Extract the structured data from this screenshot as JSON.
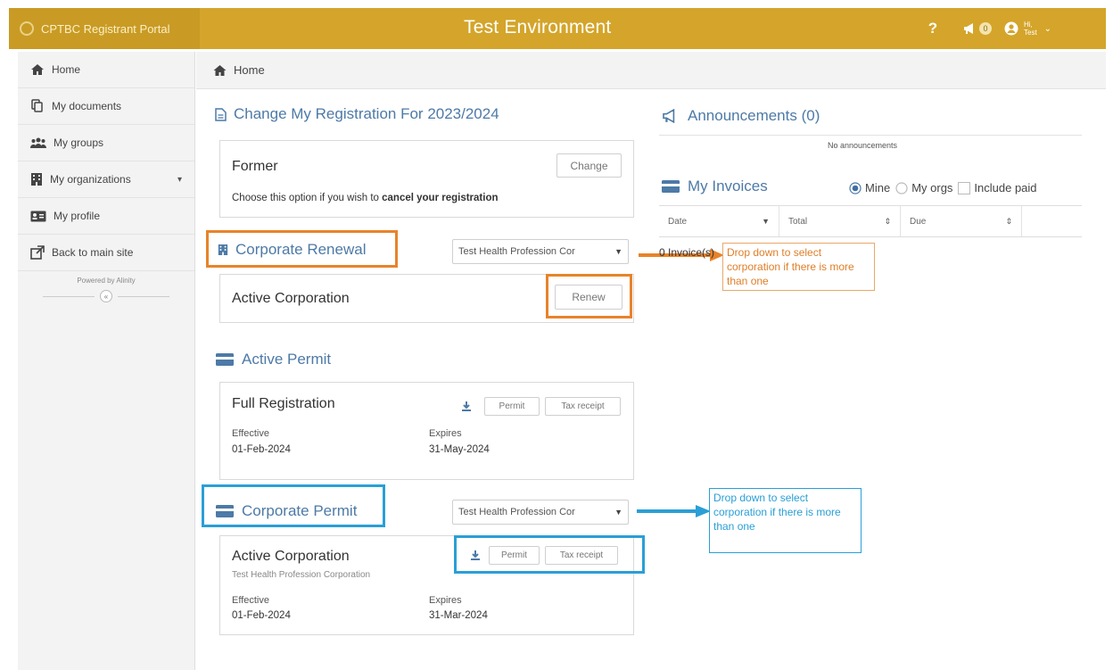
{
  "header": {
    "app_name": "CPTBC Registrant Portal",
    "environment": "Test Environment",
    "help": "?",
    "announcement_count": "0",
    "user_greeting_line1": "Hi,",
    "user_greeting_line2": "Test",
    "bar_color": "#d4a52a"
  },
  "sidebar": {
    "items": [
      {
        "label": "Home",
        "icon": "home-icon"
      },
      {
        "label": "My documents",
        "icon": "documents-icon"
      },
      {
        "label": "My groups",
        "icon": "groups-icon"
      },
      {
        "label": "My organizations",
        "icon": "building-icon"
      },
      {
        "label": "My profile",
        "icon": "id-card-icon"
      },
      {
        "label": "Back to main site",
        "icon": "external-link-icon"
      }
    ],
    "powered_by": "Powered by Alinity",
    "collapse": "«"
  },
  "breadcrumb": {
    "label": "Home"
  },
  "registration": {
    "title": "Change My Registration For 2023/2024",
    "former_title": "Former",
    "change_button": "Change",
    "desc_prefix": "Choose this option if you wish to ",
    "desc_bold": "cancel your registration"
  },
  "corporate_renewal": {
    "title": "Corporate Renewal",
    "select_value": "Test Health Profession Cor",
    "card_title": "Active Corporation",
    "renew_button": "Renew"
  },
  "active_permit": {
    "title": "Active Permit",
    "card_title": "Full Registration",
    "permit_button": "Permit",
    "tax_button": "Tax receipt",
    "effective_label": "Effective",
    "effective_value": "01-Feb-2024",
    "expires_label": "Expires",
    "expires_value": "31-May-2024"
  },
  "corporate_permit": {
    "title": "Corporate Permit",
    "select_value": "Test Health Profession Cor",
    "card_title": "Active Corporation",
    "card_subtitle": "Test Health Profession Corporation",
    "permit_button": "Permit",
    "tax_button": "Tax receipt",
    "effective_label": "Effective",
    "effective_value": "01-Feb-2024",
    "expires_label": "Expires",
    "expires_value": "31-Mar-2024"
  },
  "announcements": {
    "title": "Announcements (0)",
    "empty": "No announcements"
  },
  "invoices": {
    "title": "My Invoices",
    "radio_mine": "Mine",
    "radio_orgs": "My orgs",
    "include_paid": "Include paid",
    "columns": [
      "Date",
      "Total",
      "Due"
    ],
    "count_text": "0 Invoice(s)"
  },
  "annotations": {
    "orange_note": "Drop down to select corporation if there is more than one",
    "blue_note": "Drop down to select corporation if there is more than one",
    "orange_color": "#e8832a",
    "blue_color": "#2a9fd6"
  }
}
